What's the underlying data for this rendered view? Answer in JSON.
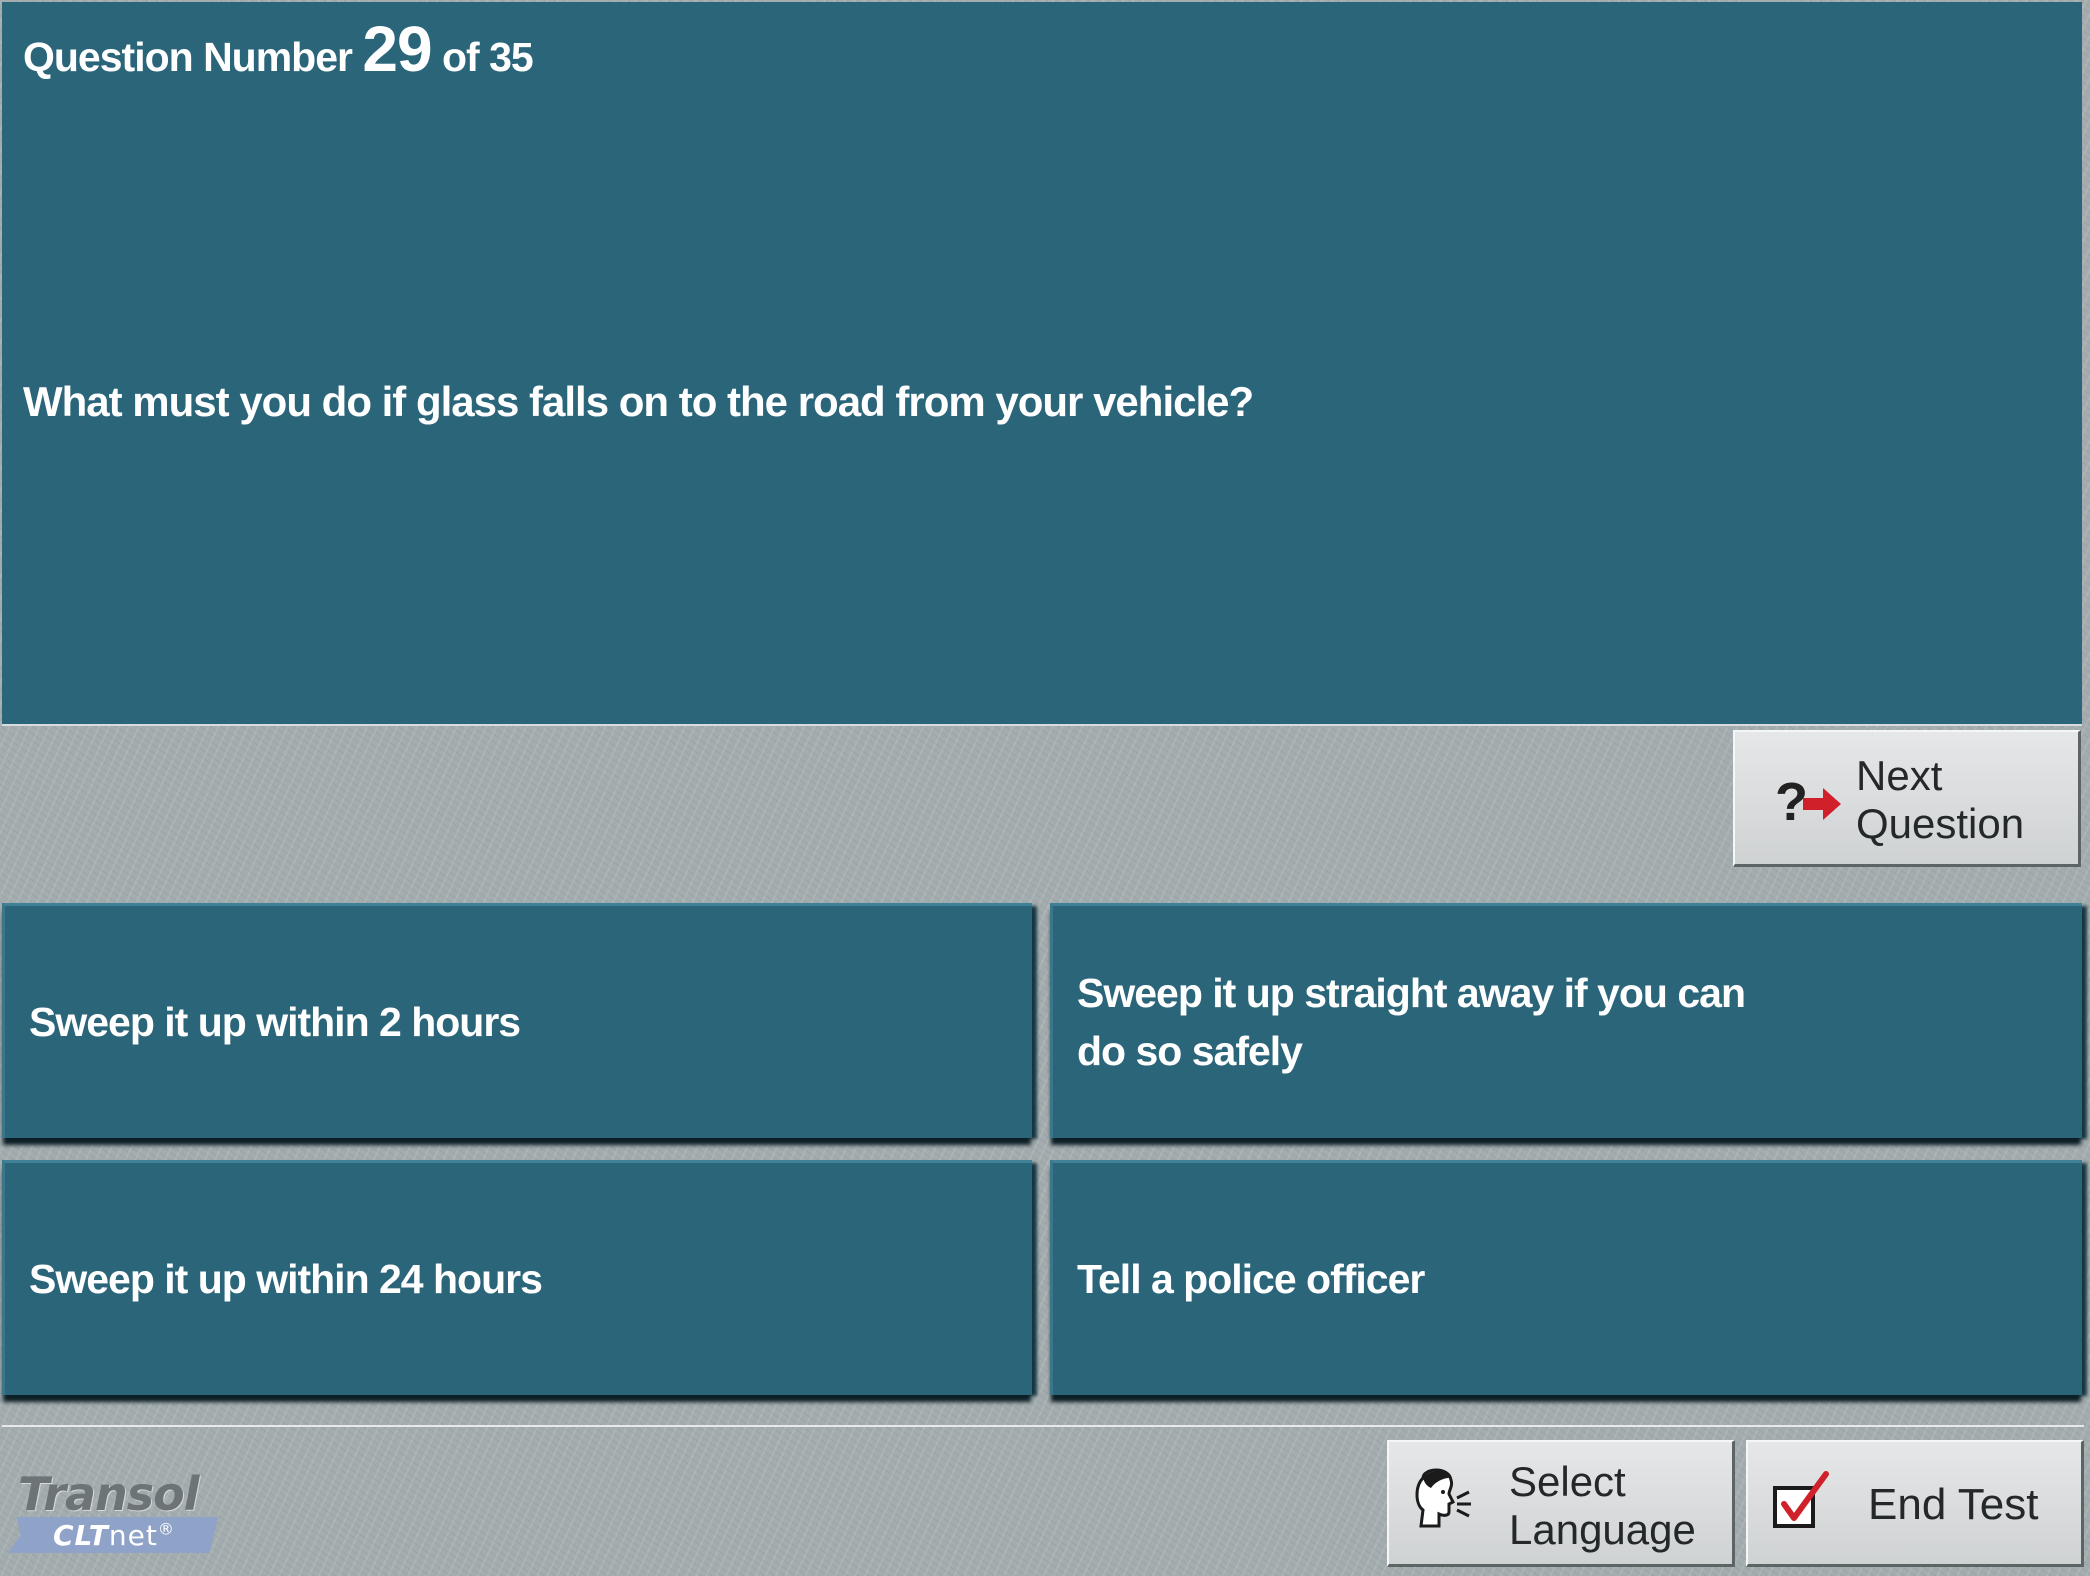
{
  "header": {
    "question_prefix": "Question Number",
    "question_number": "29",
    "question_suffix": "of 35"
  },
  "question": {
    "text": "What must you do if glass falls on to the road from your vehicle?"
  },
  "next_button": {
    "label": "Next\nQuestion",
    "icon": "question-arrow-icon",
    "icon_glyph": "?"
  },
  "answers": [
    {
      "label": "Sweep it up within 2 hours"
    },
    {
      "label": "Sweep it up straight away if you can do so safely"
    },
    {
      "label": "Sweep it up within 24 hours"
    },
    {
      "label": "Tell a police officer"
    }
  ],
  "footer": {
    "logo_word": "Transol",
    "logo_sub_bold": "CLT",
    "logo_sub_light": "net",
    "logo_mark": "®",
    "language_button": {
      "label": "Select\nLanguage",
      "icon": "speaking-head-icon"
    },
    "end_button": {
      "label": "End Test",
      "icon": "checkbox-tick-icon"
    }
  },
  "colors": {
    "panel": "#2b6579",
    "background": "#a3acae",
    "arrow": "#d0202a",
    "tick": "#d0202a"
  }
}
